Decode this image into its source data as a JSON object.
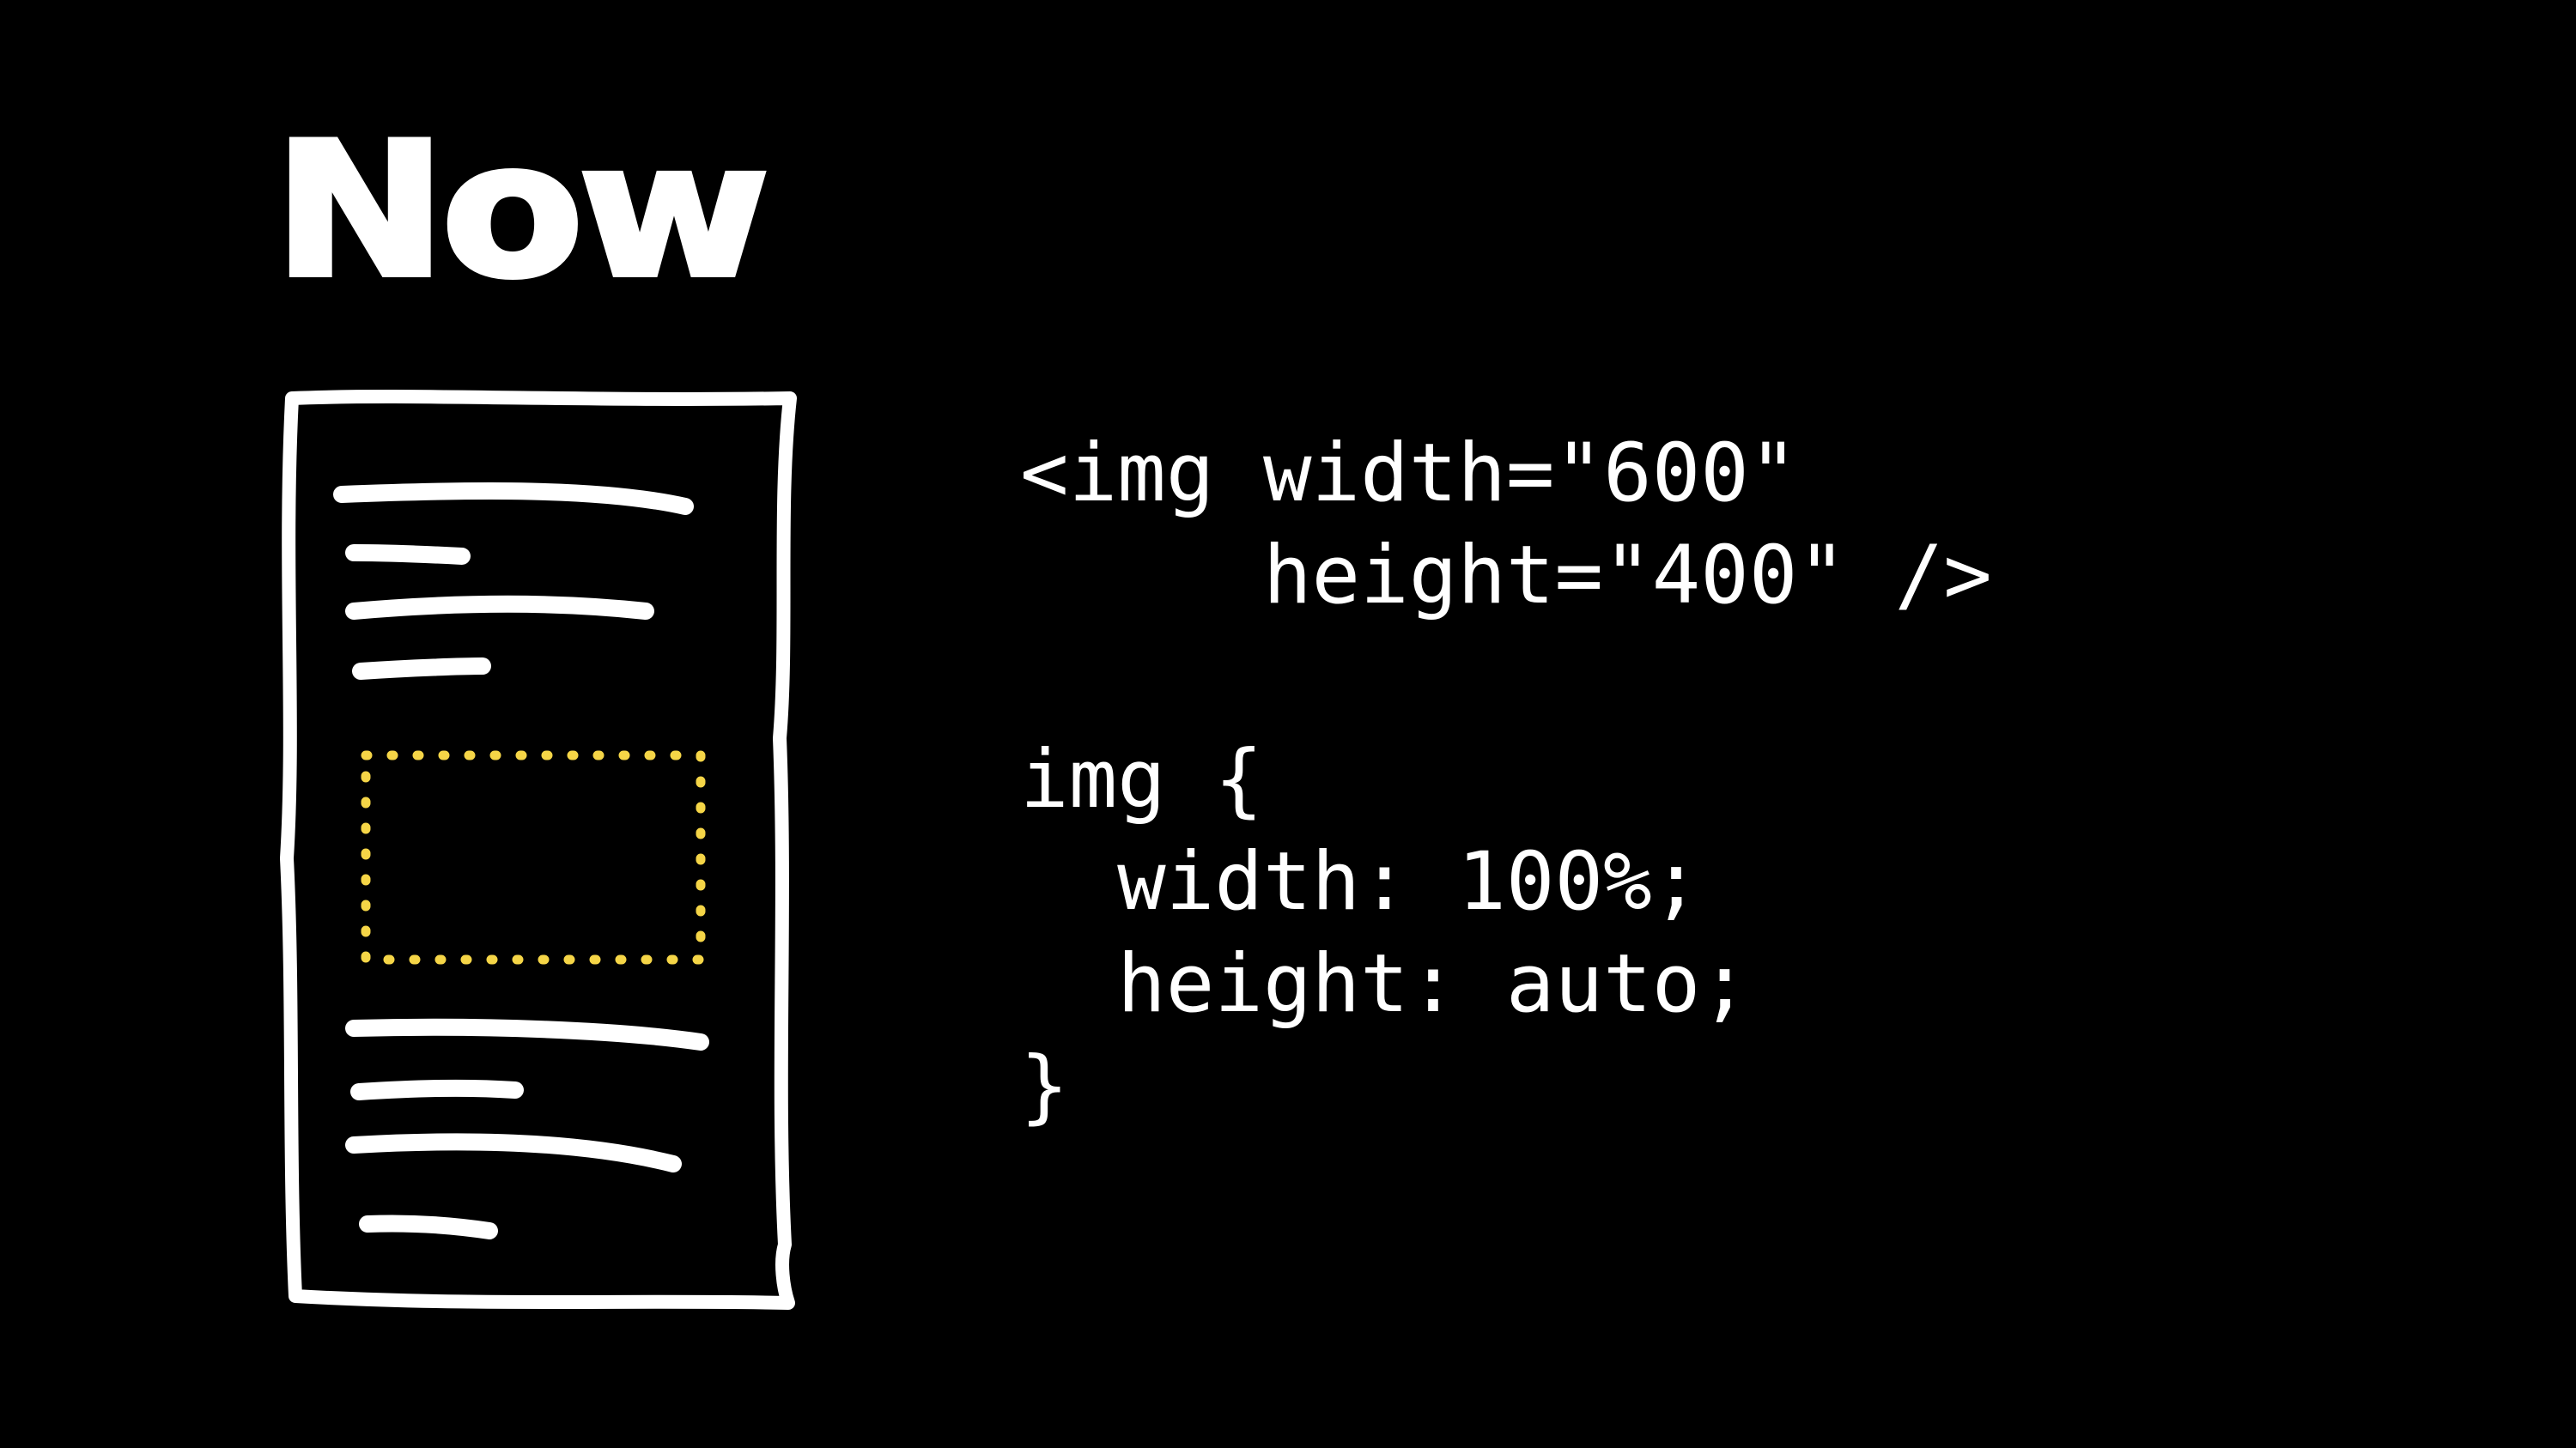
{
  "title": "Now",
  "code_lines": [
    "<img width=\"600\"",
    "     height=\"400\" />",
    "",
    "img {",
    "  width: 100%;",
    "  height: auto;",
    "}"
  ],
  "colors": {
    "background": "#000000",
    "foreground": "#ffffff",
    "image_placeholder": "#f5d547"
  },
  "icons": {
    "sketch": "phone-wireframe-sketch",
    "placeholder": "dotted-image-placeholder"
  }
}
